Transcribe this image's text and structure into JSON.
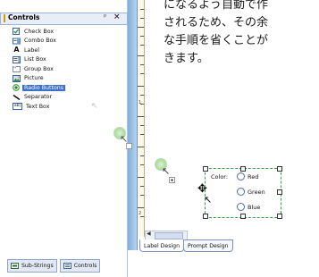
{
  "panel": {
    "title": "Controls",
    "pin_glyph": "ᵖ",
    "close_glyph": "×",
    "tools": [
      {
        "label": "Check Box",
        "icon": "checkbox-icon"
      },
      {
        "label": "Combo Box",
        "icon": "combobox-icon"
      },
      {
        "label": "Label",
        "icon": "label-icon"
      },
      {
        "label": "List Box",
        "icon": "listbox-icon"
      },
      {
        "label": "Group Box",
        "icon": "groupbox-icon"
      },
      {
        "label": "Picture",
        "icon": "picture-icon"
      },
      {
        "label": "Radio Buttons",
        "icon": "radio-icon",
        "selected": true
      },
      {
        "label": "Separator",
        "icon": "separator-icon"
      },
      {
        "label": "Text Box",
        "icon": "textbox-icon"
      }
    ],
    "bottom_tabs": [
      "Sub-Strings",
      "Controls"
    ],
    "label_glyph": "A",
    "textbox_glyph": "ab|"
  },
  "designer": {
    "tabs": [
      "Label Design",
      "Prompt Design"
    ],
    "active_tab": "Label Design",
    "ruler_numbers": [
      "1",
      "2"
    ],
    "description_lines": [
      "になるよう自動で作",
      "されるため、その余",
      "な手順を省くことが",
      "きます。"
    ],
    "radio_group": {
      "label": "Color:",
      "options": [
        "Red",
        "Green",
        "Blue"
      ]
    }
  },
  "colors": {
    "selection": "#3c6fc8",
    "group_border": "#2f9e44",
    "strip": "#7eaedc"
  }
}
